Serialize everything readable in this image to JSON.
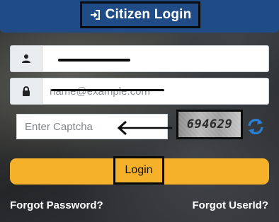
{
  "header": {
    "title": "Citizen Login",
    "icon": "sign-in-icon",
    "background_color": "#1f4c86"
  },
  "form": {
    "username": {
      "icon": "user-icon",
      "value": ""
    },
    "email": {
      "icon": "lock-icon",
      "placeholder": "name@example.com",
      "value": ""
    },
    "captcha": {
      "placeholder": "Enter Captcha",
      "image_text": "694629",
      "refresh_icon": "refresh-icon"
    },
    "login_label": "Login",
    "login_color": "#f6b12a"
  },
  "links": {
    "forgot_password": "Forgot Password?",
    "forgot_userid": "Forgot UserId?"
  },
  "annotation": {
    "arrow_icon": "left-arrow-icon"
  }
}
